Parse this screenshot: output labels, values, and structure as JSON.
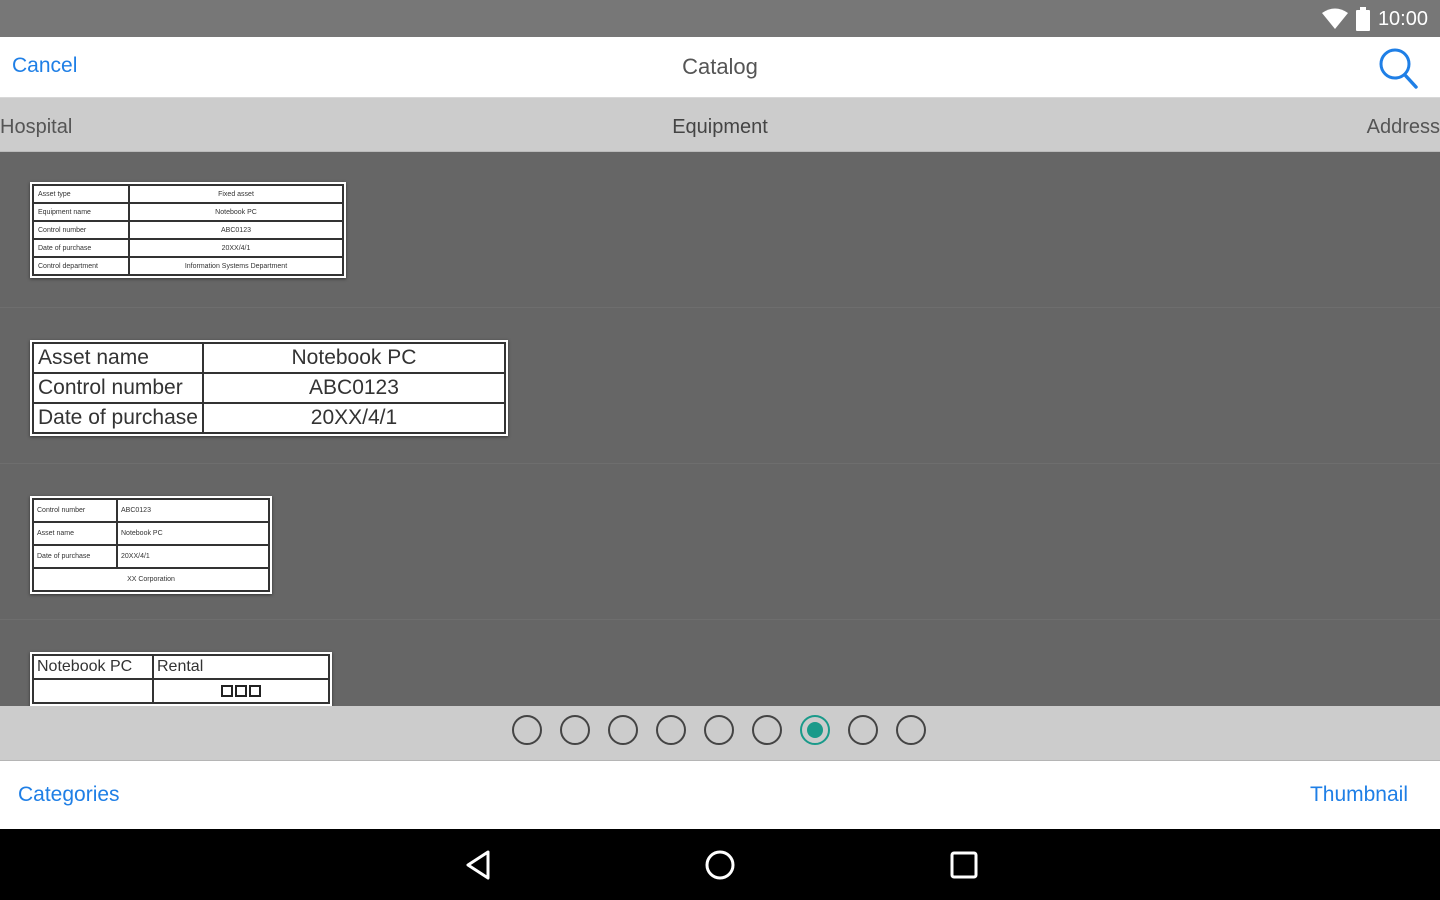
{
  "status_bar": {
    "time": "10:00",
    "icons": [
      "wifi-icon",
      "battery-icon"
    ]
  },
  "nav": {
    "cancel_label": "Cancel",
    "title": "Catalog",
    "search_icon": "search-icon"
  },
  "categories_tabs": {
    "left": "Hospital",
    "center": "Equipment",
    "right": "Address"
  },
  "labels": [
    {
      "rows": [
        {
          "key": "Asset type",
          "value": "Fixed asset"
        },
        {
          "key": "Equipment name",
          "value": "Notebook PC"
        },
        {
          "key": "Control number",
          "value": "ABC0123"
        },
        {
          "key": "Date of purchase",
          "value": "20XX/4/1"
        },
        {
          "key": "Control department",
          "value": "Information Systems Department"
        }
      ]
    },
    {
      "rows": [
        {
          "key": "Asset name",
          "value": "Notebook PC"
        },
        {
          "key": "Control number",
          "value": "ABC0123"
        },
        {
          "key": "Date of purchase",
          "value": "20XX/4/1"
        }
      ]
    },
    {
      "rows": [
        {
          "key": "Control number",
          "value": "ABC0123"
        },
        {
          "key": "Asset name",
          "value": "Notebook PC"
        },
        {
          "key": "Date of purchase",
          "value": "20XX/4/1"
        }
      ],
      "footer": "XX Corporation"
    },
    {
      "rows": [
        {
          "key": "Notebook PC",
          "value": "Rental"
        }
      ]
    }
  ],
  "pager": {
    "count": 9,
    "active_index": 6,
    "active_color": "#1a9a8a"
  },
  "toolbar": {
    "categories_label": "Categories",
    "thumbnail_label": "Thumbnail"
  },
  "colors": {
    "accent": "#1f7fe6",
    "background": "#666666",
    "tab_bar": "#cccccc"
  }
}
